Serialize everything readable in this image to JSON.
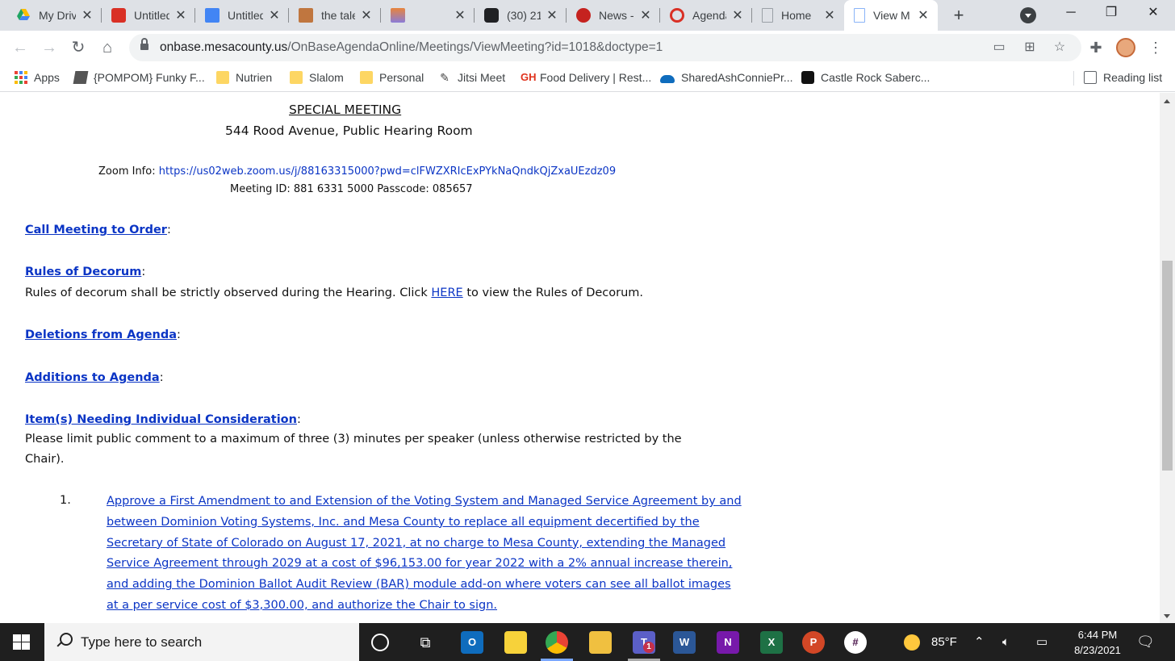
{
  "browser": {
    "tabs": [
      {
        "title": "My Drive",
        "icon": "google-drive-icon",
        "color": "#1fa463"
      },
      {
        "title": "Untitled",
        "icon": "red-app-icon",
        "color": "#d93025"
      },
      {
        "title": "Untitled",
        "icon": "google-docs-icon",
        "color": "#4285f4"
      },
      {
        "title": "the tale",
        "icon": "portrait-icon",
        "color": "#c0763f"
      },
      {
        "title": "",
        "icon": "image-icon",
        "color": "#8a7cd8"
      },
      {
        "title": "(30) 21",
        "icon": "camera-icon",
        "color": "#202124"
      },
      {
        "title": "News -",
        "icon": "news-icon",
        "color": "#c5221f"
      },
      {
        "title": "Agenda",
        "icon": "agenda-icon",
        "color": "#d93025"
      },
      {
        "title": "Home",
        "icon": "page-icon",
        "color": "#9aa0a6"
      },
      {
        "title": "View M",
        "icon": "page-icon",
        "color": "#8ab4f8",
        "active": true
      }
    ],
    "url_host": "onbase.mesacounty.us",
    "url_path": "/OnBaseAgendaOnline/Meetings/ViewMeeting?id=1018&doctype=1",
    "bookmarks": [
      {
        "label": "Apps",
        "icon": "apps-grid-icon"
      },
      {
        "label": "{POMPOM} Funky F...",
        "icon": "pompom-icon"
      },
      {
        "label": "Nutrien",
        "icon": "folder-icon"
      },
      {
        "label": "Slalom",
        "icon": "folder-icon"
      },
      {
        "label": "Personal",
        "icon": "folder-icon"
      },
      {
        "label": "Jitsi Meet",
        "icon": "jitsi-icon"
      },
      {
        "label": "Food Delivery | Rest...",
        "icon": "grubhub-icon"
      },
      {
        "label": "SharedAshConniePr...",
        "icon": "onedrive-icon"
      },
      {
        "label": "Castle Rock Saberc...",
        "icon": "hto-icon"
      }
    ],
    "reading_list": "Reading list"
  },
  "page": {
    "meeting_type": "SPECIAL MEETING",
    "venue": "544 Rood Avenue, Public Hearing Room",
    "zoom_label": "Zoom Info: ",
    "zoom_link": "https://us02web.zoom.us/j/88163315000?pwd=clFWZXRIcExPYkNaQndkQjZxaUEzdz09",
    "meeting_id": "Meeting ID: 881 6331 5000 Passcode: 085657",
    "call_to_order": "Call Meeting to Order",
    "rules_heading": "Rules of Decorum",
    "rules_text_before": "Rules of decorum shall be strictly observed during the Hearing. Click ",
    "rules_link": "HERE",
    "rules_text_after": " to view the Rules of Decorum.",
    "deletions": "Deletions from Agenda",
    "additions": "Additions to Agenda",
    "individual": "Item(s) Needing Individual Consideration",
    "colon": ":",
    "comment_line1": "Please limit public comment to a maximum of three (3) minutes per speaker (unless otherwise restricted by the",
    "comment_line2": "Chair).",
    "item_number": "1.",
    "item_text": "Approve a First Amendment to and Extension of the Voting System and Managed Service Agreement by and between Dominion Voting Systems, Inc. and Mesa County to replace all equipment decertified by the Secretary of State of Colorado on August 17, 2021, at no charge to Mesa County, extending the Managed Service Agreement through 2029 at a cost of $96,153.00 for year 2022 with a 2% annual increase therein, and adding the Dominion Ballot Audit Review (BAR) module add-on where voters can see all ballot images at a per service cost of $3,300.00, and authorize the Chair to sign."
  },
  "taskbar": {
    "search_placeholder": "Type here to search",
    "weather": "85°F",
    "time": "6:44 PM",
    "date": "8/23/2021",
    "teams_badge": "1"
  }
}
